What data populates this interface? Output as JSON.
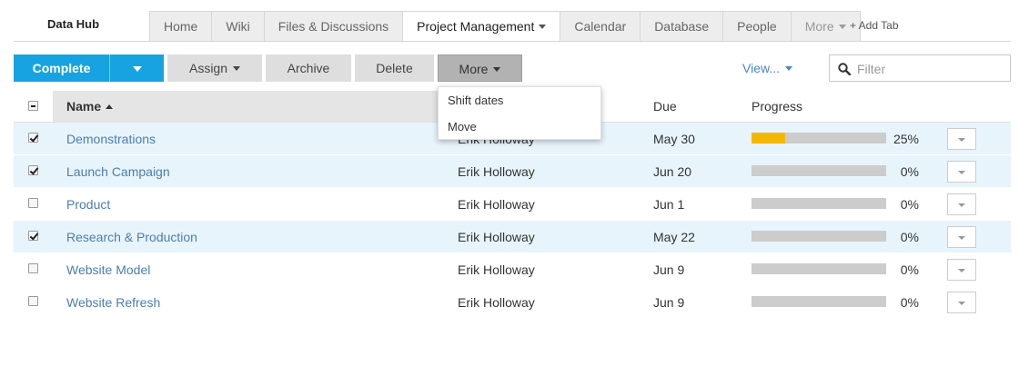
{
  "header": {
    "brand": "Data Hub",
    "tabs": [
      {
        "label": "Home"
      },
      {
        "label": "Wiki"
      },
      {
        "label": "Files & Discussions"
      },
      {
        "label": "Project Management"
      },
      {
        "label": "Calendar"
      },
      {
        "label": "Database"
      },
      {
        "label": "People"
      },
      {
        "label": "More"
      }
    ],
    "active_tab": "Project Management",
    "add_tab": "+ Add Tab"
  },
  "toolbar": {
    "complete": "Complete",
    "assign": "Assign",
    "archive": "Archive",
    "delete": "Delete",
    "more": "More",
    "view": "View...",
    "filter_placeholder": "Filter"
  },
  "more_menu": {
    "items": [
      {
        "label": "Shift dates"
      },
      {
        "label": "Move"
      }
    ]
  },
  "table": {
    "columns": {
      "name": "Name",
      "due": "Due",
      "progress": "Progress"
    },
    "rows": [
      {
        "name": "Demonstrations",
        "owner": "Erik Holloway",
        "due": "May 30",
        "progress": 25,
        "progress_label": "25%",
        "checked": true
      },
      {
        "name": "Launch Campaign",
        "owner": "Erik Holloway",
        "due": "Jun 20",
        "progress": 0,
        "progress_label": "0%",
        "checked": true
      },
      {
        "name": "Product",
        "owner": "Erik Holloway",
        "due": "Jun 1",
        "progress": 0,
        "progress_label": "0%",
        "checked": false
      },
      {
        "name": "Research & Production",
        "owner": "Erik Holloway",
        "due": "May 22",
        "progress": 0,
        "progress_label": "0%",
        "checked": true
      },
      {
        "name": "Website Model",
        "owner": "Erik Holloway",
        "due": "Jun 9",
        "progress": 0,
        "progress_label": "0%",
        "checked": false
      },
      {
        "name": "Website Refresh",
        "owner": "Erik Holloway",
        "due": "Jun 9",
        "progress": 0,
        "progress_label": "0%",
        "checked": false
      }
    ]
  },
  "colors": {
    "primary": "#17a3e2",
    "selected_row": "#e8f4fc",
    "link": "#4a7eb0",
    "progress_fill": "#f5b800",
    "progress_track": "#cccccc"
  }
}
